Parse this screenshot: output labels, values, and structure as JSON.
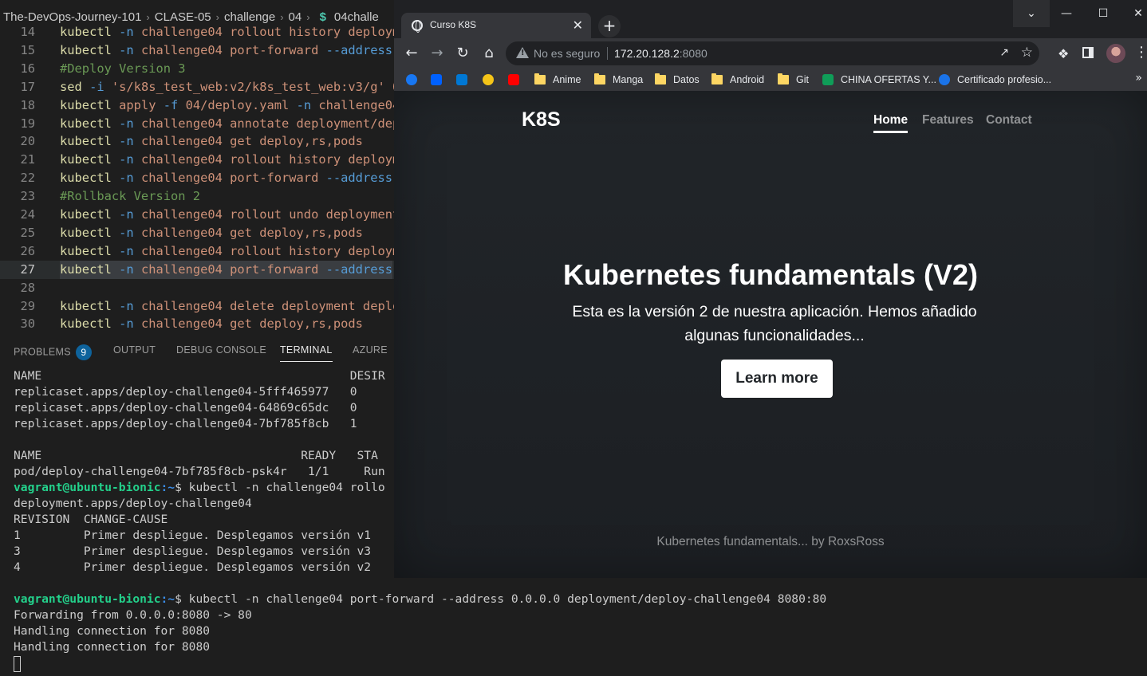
{
  "vscode": {
    "breadcrumb": [
      "The-DevOps-Journey-101",
      "CLASE-05",
      "challenge",
      "04",
      "04challe"
    ],
    "editor_lines": [
      {
        "num": "14",
        "tokens": [
          [
            "kubectl ",
            "cmd"
          ],
          [
            "-n ",
            "flag"
          ],
          [
            "challenge04 rollout history deploym",
            "arg"
          ]
        ]
      },
      {
        "num": "15",
        "tokens": [
          [
            "kubectl ",
            "cmd"
          ],
          [
            "-n ",
            "flag"
          ],
          [
            "challenge04 port-forward ",
            "arg"
          ],
          [
            "--address",
            "flag"
          ]
        ]
      },
      {
        "num": "16",
        "tokens": [
          [
            "#Deploy Version 3",
            "comment"
          ]
        ]
      },
      {
        "num": "17",
        "tokens": [
          [
            "sed ",
            "cmd"
          ],
          [
            "-i ",
            "flag"
          ],
          [
            "'s/k8s_test_web:v2/k8s_test_web:v3/g' 0",
            "str"
          ]
        ]
      },
      {
        "num": "18",
        "tokens": [
          [
            "kubectl ",
            "cmd"
          ],
          [
            "apply ",
            "arg"
          ],
          [
            "-f ",
            "flag"
          ],
          [
            "04/deploy.yaml ",
            "arg"
          ],
          [
            "-n ",
            "flag"
          ],
          [
            "challenge04",
            "arg"
          ]
        ]
      },
      {
        "num": "19",
        "tokens": [
          [
            "kubectl ",
            "cmd"
          ],
          [
            "-n ",
            "flag"
          ],
          [
            "challenge04 annotate deployment/dep",
            "arg"
          ]
        ]
      },
      {
        "num": "20",
        "tokens": [
          [
            "kubectl ",
            "cmd"
          ],
          [
            "-n ",
            "flag"
          ],
          [
            "challenge04 get deploy,rs,pods",
            "arg"
          ]
        ]
      },
      {
        "num": "21",
        "tokens": [
          [
            "kubectl ",
            "cmd"
          ],
          [
            "-n ",
            "flag"
          ],
          [
            "challenge04 rollout history deploym",
            "arg"
          ]
        ]
      },
      {
        "num": "22",
        "tokens": [
          [
            "kubectl ",
            "cmd"
          ],
          [
            "-n ",
            "flag"
          ],
          [
            "challenge04 port-forward ",
            "arg"
          ],
          [
            "--address",
            "flag"
          ]
        ]
      },
      {
        "num": "23",
        "tokens": [
          [
            "#Rollback Version 2",
            "comment"
          ]
        ]
      },
      {
        "num": "24",
        "tokens": [
          [
            "kubectl ",
            "cmd"
          ],
          [
            "-n ",
            "flag"
          ],
          [
            "challenge04 rollout undo deployment",
            "arg"
          ]
        ]
      },
      {
        "num": "25",
        "tokens": [
          [
            "kubectl ",
            "cmd"
          ],
          [
            "-n ",
            "flag"
          ],
          [
            "challenge04 get deploy,rs,pods",
            "arg"
          ]
        ]
      },
      {
        "num": "26",
        "tokens": [
          [
            "kubectl ",
            "cmd"
          ],
          [
            "-n ",
            "flag"
          ],
          [
            "challenge04 rollout history deploym",
            "arg"
          ]
        ]
      },
      {
        "num": "27",
        "tokens": [
          [
            "kubectl ",
            "cmd"
          ],
          [
            "-n ",
            "flag"
          ],
          [
            "challenge04 port-forward ",
            "arg"
          ],
          [
            "--address",
            "flag"
          ]
        ],
        "active": true
      },
      {
        "num": "28",
        "tokens": []
      },
      {
        "num": "29",
        "tokens": [
          [
            "kubectl ",
            "cmd"
          ],
          [
            "-n ",
            "flag"
          ],
          [
            "challenge04 delete deployment deplo",
            "arg"
          ]
        ]
      },
      {
        "num": "30",
        "tokens": [
          [
            "kubectl ",
            "cmd"
          ],
          [
            "-n ",
            "flag"
          ],
          [
            "challenge04 get deploy,rs,pods",
            "arg"
          ]
        ]
      }
    ],
    "panel_tabs": {
      "problems": "PROBLEMS",
      "problems_count": "9",
      "output": "OUTPUT",
      "debug_console": "DEBUG CONSOLE",
      "terminal": "TERMINAL",
      "azure": "AZURE"
    },
    "terminal_lines": [
      {
        "text": "NAME                                            DESIR"
      },
      {
        "text": "replicaset.apps/deploy-challenge04-5fff465977   0"
      },
      {
        "text": "replicaset.apps/deploy-challenge04-64869c65dc   0"
      },
      {
        "text": "replicaset.apps/deploy-challenge04-7bf785f8cb   1"
      },
      {
        "text": ""
      },
      {
        "text": "NAME                                     READY   STA"
      },
      {
        "text": "pod/deploy-challenge04-7bf785f8cb-psk4r   1/1     Run"
      },
      {
        "prompt_user": "vagrant@ubuntu-bionic",
        "prompt_path": ":~",
        "text": "$ kubectl -n challenge04 rollo"
      },
      {
        "text": "deployment.apps/deploy-challenge04"
      },
      {
        "text": "REVISION  CHANGE-CAUSE"
      },
      {
        "text": "1         Primer despliegue. Desplegamos versión v1"
      },
      {
        "text": "3         Primer despliegue. Desplegamos versión v3"
      },
      {
        "text": "4         Primer despliegue. Desplegamos versión v2"
      },
      {
        "text": ""
      },
      {
        "prompt_user": "vagrant@ubuntu-bionic",
        "prompt_path": ":~",
        "text": "$ kubectl -n challenge04 port-forward --address 0.0.0.0 deployment/deploy-challenge04 8080:80"
      },
      {
        "text": "Forwarding from 0.0.0.0:8080 -> 80"
      },
      {
        "text": "Handling connection for 8080"
      },
      {
        "text": "Handling connection for 8080"
      }
    ]
  },
  "chrome": {
    "tab_title": "Curso K8S",
    "tab_close_glyph": "✕",
    "new_tab_glyph": "+",
    "window_controls": {
      "chevron": "⌄",
      "minimize": "—",
      "maximize": "☐",
      "close": "✕"
    },
    "security_label": "No es seguro",
    "url_host": "172.20.128.2",
    "url_port": ":8080",
    "bookmarks": [
      {
        "icon": "facebook-icon",
        "color": "#1877f2",
        "label": ""
      },
      {
        "icon": "dropbox-icon",
        "color": "#0061ff",
        "label": ""
      },
      {
        "icon": "outlook-icon",
        "color": "#0078d4",
        "label": ""
      },
      {
        "icon": "d-icon",
        "color": "#f5c518",
        "label": ""
      },
      {
        "icon": "youtube-icon",
        "color": "#ff0000",
        "label": ""
      },
      {
        "icon": "folder-icon",
        "label": "Anime"
      },
      {
        "icon": "folder-icon",
        "label": "Manga"
      },
      {
        "icon": "folder-icon",
        "label": "Datos"
      },
      {
        "icon": "folder-icon",
        "label": "Android"
      },
      {
        "icon": "folder-icon",
        "label": "Git"
      },
      {
        "icon": "sheets-icon",
        "color": "#0f9d58",
        "label": "CHINA OFERTAS Y..."
      },
      {
        "icon": "certificate-icon",
        "color": "#1a73e8",
        "label": "Certificado profesio..."
      }
    ],
    "bookmarks_more": "»"
  },
  "page": {
    "brand": "K8S",
    "nav": {
      "home": "Home",
      "features": "Features",
      "contact": "Contact"
    },
    "hero_title": "Kubernetes fundamentals (V2)",
    "hero_lead": "Esta es la versión 2 de nuestra aplicación. Hemos añadido algunas funcionalidades...",
    "cta_label": "Learn more",
    "footer": "Kubernetes fundamentals... by RoxsRoss"
  }
}
